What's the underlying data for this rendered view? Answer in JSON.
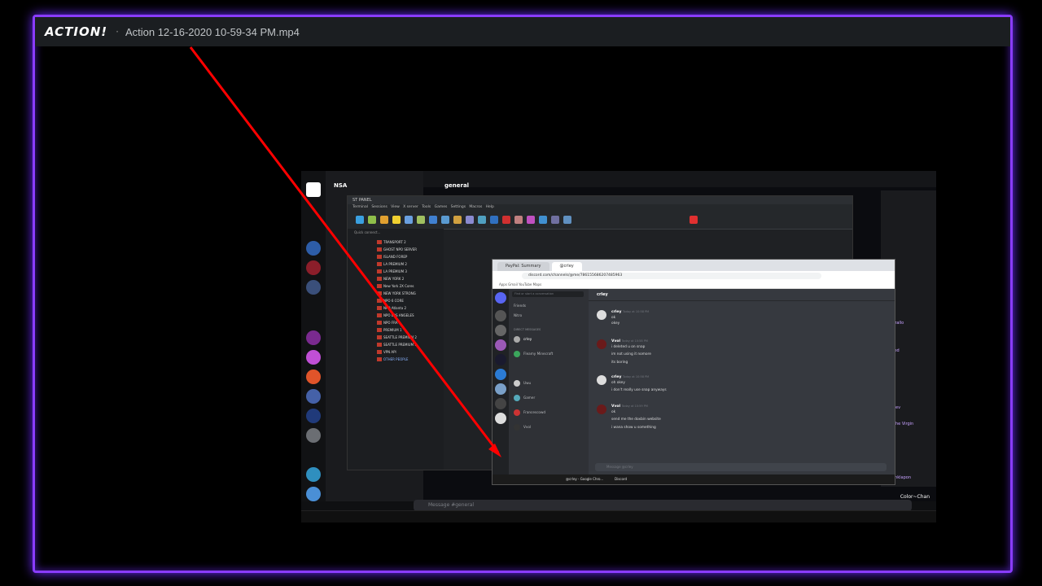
{
  "recorder": {
    "logo": "ACTION!",
    "separator": "·",
    "filename": "Action 12-16-2020 10-59-34 PM.mp4"
  },
  "discord_bg": {
    "server_name": "NSA",
    "channel": "general",
    "message_placeholder": "Message #general",
    "user_card": "Color~Chan",
    "members": [
      "Fredzallo",
      "Forced",
      "spodev",
      "Is | The Virgin",
      "narlinklapon"
    ]
  },
  "moba": {
    "title": "ST PANEL",
    "menu": [
      "Terminal",
      "Sessions",
      "View",
      "X server",
      "Tools",
      "Games",
      "Settings",
      "Macros",
      "Help"
    ],
    "tools": [
      "Session",
      "Servers",
      "Tools",
      "Games",
      "Sessions",
      "View",
      "Split",
      "MultiExec",
      "Tunneling",
      "Packages",
      "Settings",
      "Help",
      "Clone",
      "Save",
      "Fullscreen",
      "Detach",
      "Get title",
      "Tray",
      "Exit"
    ],
    "quick_connect": "Quick connect...",
    "sessions": [
      "TRANSPORT 2",
      "GHOST NPO SERVER",
      "ISLAND FOREP",
      "LA PREMIUM 2",
      "LA PREMIUM 3",
      "NEW YORK 2",
      "New York 2X Cores",
      "NEW YORK STRONG",
      "NPO 6 CORE",
      "NPO Atlanta 2",
      "NPO LOS ANGELES",
      "NPO FRA",
      "PREMIUM 1",
      "SEATTLE PREMIUM 2",
      "SEATTLE PREMIUM 3",
      "VPN API",
      "OTHER PEOPLE"
    ]
  },
  "chrome": {
    "tabs": [
      "PayPal: Summary",
      "@crley"
    ],
    "url": "discord.com/channels/@me/786155686207485963",
    "bookmarks": "Apps   Gmail   YouTube   Maps"
  },
  "discord": {
    "dm_header": "crley",
    "search_placeholder": "Find or start a conversation",
    "nav": [
      "Friends",
      "Nitro"
    ],
    "dm_section": "DIRECT MESSAGES",
    "dms": [
      "crley",
      "Fleamy Minecraft",
      "Uwu",
      "Gamer",
      "Francescowd"
    ],
    "messages": [
      {
        "author": "crley",
        "time": "Today at 10:58 PM",
        "lines": [
          "ok",
          "okey"
        ]
      },
      {
        "author": "Vvol",
        "time": "Today at 10:58 PM",
        "lines": [
          "i deleted u on snap",
          "im not using it nomore",
          "its boring"
        ]
      },
      {
        "author": "crley",
        "time": "Today at 10:58 PM",
        "lines": [
          "oh okey",
          "i don't really use snap anyways"
        ]
      },
      {
        "author": "Vvol",
        "time": "Today at 10:59 PM",
        "lines": [
          "ok",
          "send me the doxbin website",
          "i wana show u something"
        ]
      }
    ],
    "input_placeholder": "Message @crley",
    "self_name": "Vvol",
    "taskbar_apps": [
      "@crley - Google Chro...",
      "Discord"
    ]
  },
  "colors": {
    "frame": "#8a3cff",
    "arrow": "#ff0000",
    "discord_blurple": "#5865f2"
  }
}
